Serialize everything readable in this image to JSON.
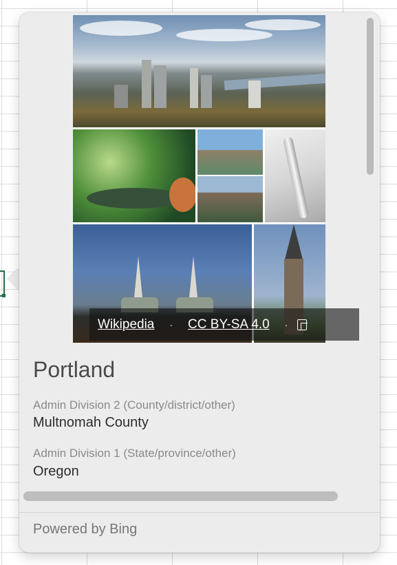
{
  "attribution": {
    "source_label": "Wikipedia",
    "separator": "·",
    "license_label": "CC BY-SA 4.0",
    "expand_icon": "expand-icon"
  },
  "place": {
    "name": "Portland",
    "fields": [
      {
        "label": "Admin Division 2 (County/district/other)",
        "value": "Multnomah County"
      },
      {
        "label": "Admin Division 1 (State/province/other)",
        "value": "Oregon"
      }
    ]
  },
  "footer": {
    "powered_by": "Powered by Bing"
  },
  "colors": {
    "card_bg": "#ececec",
    "cell_selection": "#1e7145"
  }
}
